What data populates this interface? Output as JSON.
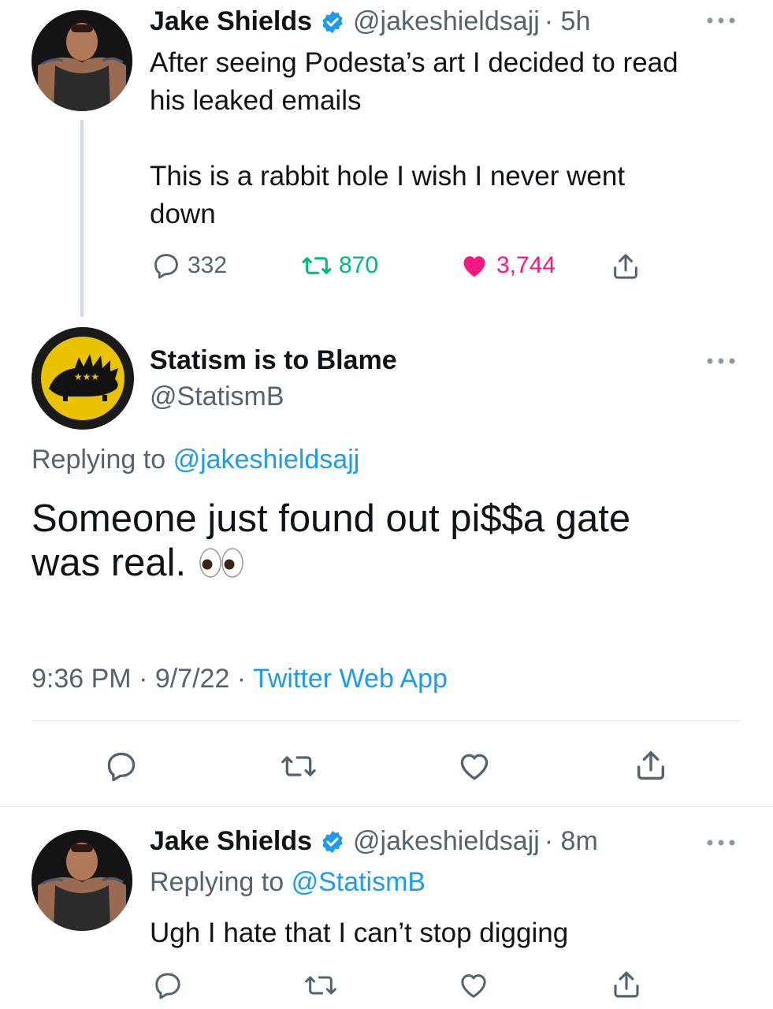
{
  "colors": {
    "accent": "#1d9bf0",
    "like": "#f91880",
    "retweet": "#00ba7c",
    "muted": "#536471"
  },
  "tweet1": {
    "author": "Jake Shields",
    "handle": "@jakeshieldsajj",
    "time": "· 5h",
    "text_line1": "After seeing Podesta’s art I decided to read",
    "text_line2": "his leaked emails",
    "text_line3": "This is a rabbit hole I wish I never went",
    "text_line4": "down",
    "replies": "332",
    "retweets": "870",
    "likes": "3,744"
  },
  "tweet2": {
    "author": "Statism is to Blame",
    "handle": "@StatismB",
    "replying_label": "Replying to",
    "replying_handle": "@jakeshieldsajj",
    "text_line1": "Someone just found out pi$$a gate",
    "text_line2": "was real.",
    "emoji": "eyes",
    "timestamp": "9:36 PM · 9/7/22 ·",
    "source": "Twitter Web App"
  },
  "tweet3": {
    "author": "Jake Shields",
    "handle": "@jakeshieldsajj",
    "time": "· 8m",
    "replying_label": "Replying to",
    "replying_handle": "@StatismB",
    "text": "Ugh I hate that I can’t stop digging"
  },
  "icons": [
    "reply-icon",
    "retweet-icon",
    "like-icon",
    "share-icon",
    "verified-badge-icon",
    "more-icon",
    "eyes-emoji"
  ]
}
